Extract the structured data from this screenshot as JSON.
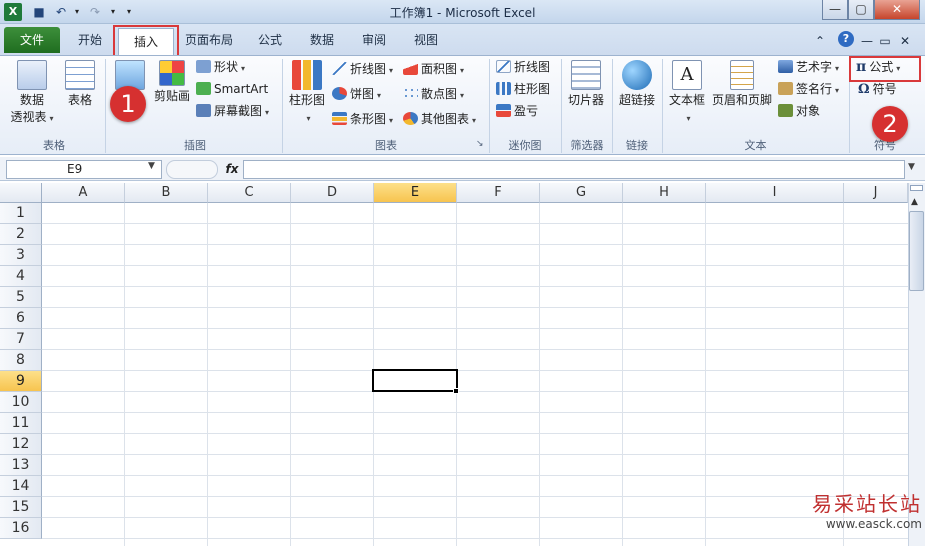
{
  "window": {
    "title": "工作簿1 - Microsoft Excel",
    "minimize": "—",
    "maximize": "▢",
    "close": "✕"
  },
  "qat": {
    "app_icon": "X",
    "save": "■",
    "undo": "↶",
    "redo": "↷",
    "customize": "▾"
  },
  "tabs": {
    "file": "文件",
    "home": "开始",
    "insert": "插入",
    "page_layout": "页面布局",
    "formulas": "公式",
    "data": "数据",
    "review": "审阅",
    "view": "视图"
  },
  "tab_right": {
    "collapse": "⌃",
    "help": "?",
    "min": "—",
    "restore": "▭",
    "close": "✕"
  },
  "ribbon": {
    "tables": {
      "pivot_line1": "数据",
      "pivot_line2": "透视表",
      "table": "表格",
      "label": "表格"
    },
    "illustrations": {
      "picture": "图片",
      "clipart": "剪贴画",
      "shapes": "形状",
      "smartart": "SmartArt",
      "screenshot": "屏幕截图",
      "label": "插图"
    },
    "charts": {
      "column": "柱形图",
      "line": "折线图",
      "pie": "饼图",
      "bar": "条形图",
      "area": "面积图",
      "scatter": "散点图",
      "other": "其他图表",
      "label": "图表"
    },
    "sparklines": {
      "line": "折线图",
      "column": "柱形图",
      "winloss": "盈亏",
      "label": "迷你图"
    },
    "filter": {
      "slicer": "切片器",
      "label": "筛选器"
    },
    "links": {
      "hyperlink": "超链接",
      "label": "链接"
    },
    "text": {
      "textbox": "文本框",
      "header_footer": "页眉和页脚",
      "wordart": "艺术字",
      "signature": "签名行",
      "object": "对象",
      "label": "文本"
    },
    "symbols": {
      "equation": "公式",
      "equation_glyph": "π",
      "symbol": "符号",
      "symbol_glyph": "Ω",
      "label": "符号"
    }
  },
  "formula_bar": {
    "name_box": "E9",
    "fx": "fx",
    "formula": ""
  },
  "sheet": {
    "columns": [
      "A",
      "B",
      "C",
      "D",
      "E",
      "F",
      "G",
      "H",
      "I",
      "J"
    ],
    "rows": [
      "1",
      "2",
      "3",
      "4",
      "5",
      "6",
      "7",
      "8",
      "9",
      "10",
      "11",
      "12",
      "13",
      "14",
      "15",
      "16"
    ],
    "selected_column": "E",
    "selected_row": "9"
  },
  "callouts": {
    "one": "1",
    "two": "2"
  },
  "colors": {
    "callout": "#d63030",
    "highlight_box": "#d9393b",
    "file_tab": "#2a7d2a",
    "header_selected": "#f7c44f"
  },
  "watermark": {
    "main": "易采站长站",
    "url": "www.easck.com"
  }
}
